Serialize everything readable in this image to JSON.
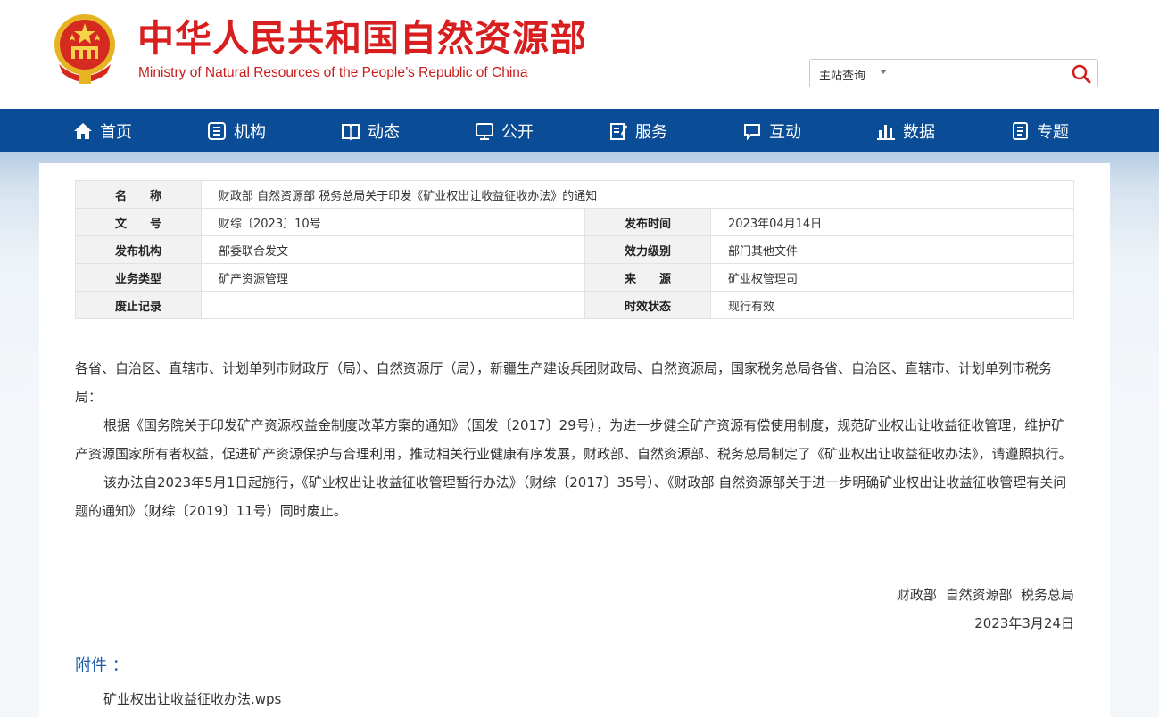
{
  "header": {
    "title_cn": "中华人民共和国自然资源部",
    "title_en": "Ministry of Natural Resources of the People’s Republic of China",
    "search": {
      "scope": "主站查询",
      "placeholder": ""
    }
  },
  "nav": [
    {
      "label": "首页",
      "icon": "home-icon"
    },
    {
      "label": "机构",
      "icon": "org-icon"
    },
    {
      "label": "动态",
      "icon": "news-book-icon"
    },
    {
      "label": "公开",
      "icon": "monitor-icon"
    },
    {
      "label": "服务",
      "icon": "edit-doc-icon"
    },
    {
      "label": "互动",
      "icon": "chat-icon"
    },
    {
      "label": "数据",
      "icon": "bar-chart-icon"
    },
    {
      "label": "专题",
      "icon": "topic-doc-icon"
    }
  ],
  "meta": {
    "name_label": "名　　称",
    "name_value": "财政部 自然资源部 税务总局关于印发《矿业权出让收益征收办法》的通知",
    "docno_label": "文　　号",
    "docno_value": "财综〔2023〕10号",
    "pubtime_label": "发布时间",
    "pubtime_value": "2023年04月14日",
    "issuer_label": "发布机构",
    "issuer_value": "部委联合发文",
    "level_label": "效力级别",
    "level_value": "部门其他文件",
    "type_label": "业务类型",
    "type_value": "矿产资源管理",
    "source_label": "来　　源",
    "source_value": "矿业权管理司",
    "abolish_label": "废止记录",
    "abolish_value": "",
    "status_label": "时效状态",
    "status_value": "现行有效"
  },
  "body": {
    "p1": "各省、自治区、直辖市、计划单列市财政厅（局）、自然资源厅（局），新疆生产建设兵团财政局、自然资源局，国家税务总局各省、自治区、直辖市、计划单列市税务局：",
    "p2": "根据《国务院关于印发矿产资源权益金制度改革方案的通知》（国发〔2017〕29号），为进一步健全矿产资源有偿使用制度，规范矿业权出让收益征收管理，维护矿产资源国家所有者权益，促进矿产资源保护与合理利用，推动相关行业健康有序发展，财政部、自然资源部、税务总局制定了《矿业权出让收益征收办法》，请遵照执行。",
    "p3": "该办法自2023年5月1日起施行，《矿业权出让收益征收管理暂行办法》（财综〔2017〕35号）、《财政部 自然资源部关于进一步明确矿业权出让收益征收管理有关问题的通知》（财综〔2019〕11号）同时废止。",
    "signers": "财政部  自然资源部  税务总局",
    "date": "2023年3月24日"
  },
  "attachment": {
    "title": "附件 ：",
    "file": "矿业权出让收益征收办法.wps"
  },
  "colors": {
    "nav_bg": "#0b4c97",
    "title_red": "#d81e1e",
    "attach_blue": "#1f5da8"
  }
}
